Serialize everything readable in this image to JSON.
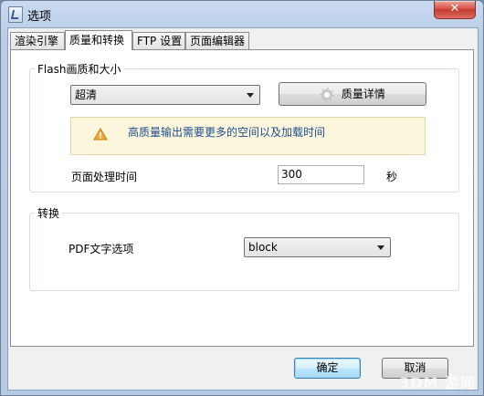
{
  "window": {
    "title": "选项",
    "close_label": "✕"
  },
  "tabs": [
    {
      "label": "渲染引擎",
      "active": false
    },
    {
      "label": "质量和转换",
      "active": true
    },
    {
      "label": "FTP 设置",
      "active": false
    },
    {
      "label": "页面编辑器",
      "active": false
    }
  ],
  "flash_group": {
    "label": "Flash画质和大小",
    "quality_select": {
      "value": "超清"
    },
    "details_button": {
      "label": "质量详情",
      "icon": "gear-icon"
    },
    "notice": {
      "icon": "warning-icon",
      "text": "高质量输出需要更多的空间以及加载时间"
    },
    "page_time": {
      "label": "页面处理时间",
      "value": "300",
      "unit": "秒"
    }
  },
  "convert_group": {
    "label": "转换",
    "pdf_text": {
      "label": "PDF文字选项",
      "value": "block"
    }
  },
  "footer": {
    "ok_label": "确定",
    "cancel_label": "取消"
  },
  "watermark": "3DM 游网"
}
